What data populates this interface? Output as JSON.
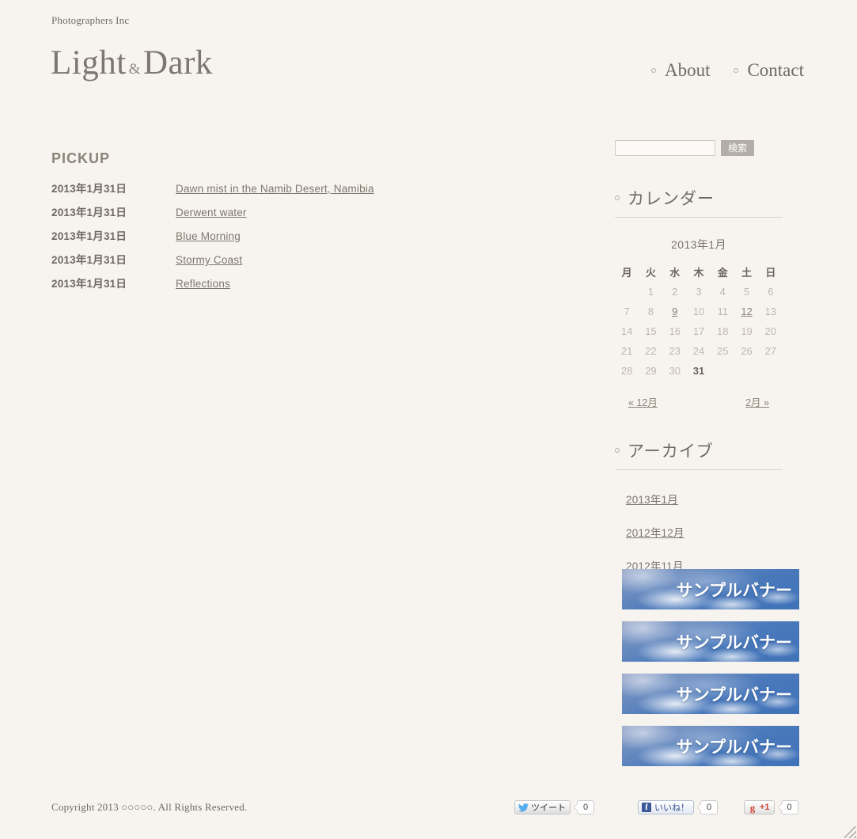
{
  "header": {
    "tagline": "Photographers Inc",
    "logo_first": "Light",
    "logo_amp": "&",
    "logo_second": "Dark",
    "nav": [
      {
        "label": "About"
      },
      {
        "label": "Contact"
      }
    ]
  },
  "main": {
    "pickup_title": "PICKUP",
    "pickup": [
      {
        "date": "2013年1月31日",
        "title": "Dawn mist in the Namib Desert, Namibia"
      },
      {
        "date": "2013年1月31日",
        "title": "Derwent water"
      },
      {
        "date": "2013年1月31日",
        "title": "Blue Morning"
      },
      {
        "date": "2013年1月31日",
        "title": "Stormy Coast"
      },
      {
        "date": "2013年1月31日",
        "title": "Reflections"
      }
    ]
  },
  "sidebar": {
    "search": {
      "value": "",
      "placeholder": "",
      "button_label": "検索"
    },
    "calendar": {
      "heading": "カレンダー",
      "caption": "2013年1月",
      "weekdays": [
        "月",
        "火",
        "水",
        "木",
        "金",
        "土",
        "日"
      ],
      "weeks": [
        [
          {
            "day": "",
            "state": "empty"
          },
          {
            "day": "1",
            "state": "normal"
          },
          {
            "day": "2",
            "state": "normal"
          },
          {
            "day": "3",
            "state": "normal"
          },
          {
            "day": "4",
            "state": "normal"
          },
          {
            "day": "5",
            "state": "normal"
          },
          {
            "day": "6",
            "state": "normal"
          }
        ],
        [
          {
            "day": "7",
            "state": "normal"
          },
          {
            "day": "8",
            "state": "normal"
          },
          {
            "day": "9",
            "state": "link"
          },
          {
            "day": "10",
            "state": "normal"
          },
          {
            "day": "11",
            "state": "normal"
          },
          {
            "day": "12",
            "state": "link"
          },
          {
            "day": "13",
            "state": "normal"
          }
        ],
        [
          {
            "day": "14",
            "state": "normal"
          },
          {
            "day": "15",
            "state": "normal"
          },
          {
            "day": "16",
            "state": "normal"
          },
          {
            "day": "17",
            "state": "normal"
          },
          {
            "day": "18",
            "state": "normal"
          },
          {
            "day": "19",
            "state": "normal"
          },
          {
            "day": "20",
            "state": "normal"
          }
        ],
        [
          {
            "day": "21",
            "state": "normal"
          },
          {
            "day": "22",
            "state": "normal"
          },
          {
            "day": "23",
            "state": "normal"
          },
          {
            "day": "24",
            "state": "normal"
          },
          {
            "day": "25",
            "state": "normal"
          },
          {
            "day": "26",
            "state": "normal"
          },
          {
            "day": "27",
            "state": "normal"
          }
        ],
        [
          {
            "day": "28",
            "state": "normal"
          },
          {
            "day": "29",
            "state": "normal"
          },
          {
            "day": "30",
            "state": "normal"
          },
          {
            "day": "31",
            "state": "today"
          },
          {
            "day": "",
            "state": "empty"
          },
          {
            "day": "",
            "state": "empty"
          },
          {
            "day": "",
            "state": "empty"
          }
        ]
      ],
      "prev_label": "« 12月",
      "next_label": "2月 »"
    },
    "archives": {
      "heading": "アーカイブ",
      "items": [
        {
          "label": "2013年1月"
        },
        {
          "label": "2012年12月"
        },
        {
          "label": "2012年11月"
        }
      ]
    },
    "banners": [
      {
        "text": "サンプルバナー"
      },
      {
        "text": "サンプルバナー"
      },
      {
        "text": "サンプルバナー"
      },
      {
        "text": "サンプルバナー"
      }
    ]
  },
  "footer": {
    "copyright": "Copyright 2013 ○○○○○. All Rights Reserved.",
    "social": {
      "twitter": {
        "label": "ツイート",
        "count": "0"
      },
      "facebook": {
        "label": "いいね！",
        "count": "0"
      },
      "googleplus": {
        "label": "+1",
        "count": "0"
      }
    }
  },
  "colors": {
    "background": "#f7f4ef",
    "text": "#7a7268",
    "banner_blue": "#4a79bb",
    "search_button": "#b3aea7"
  }
}
